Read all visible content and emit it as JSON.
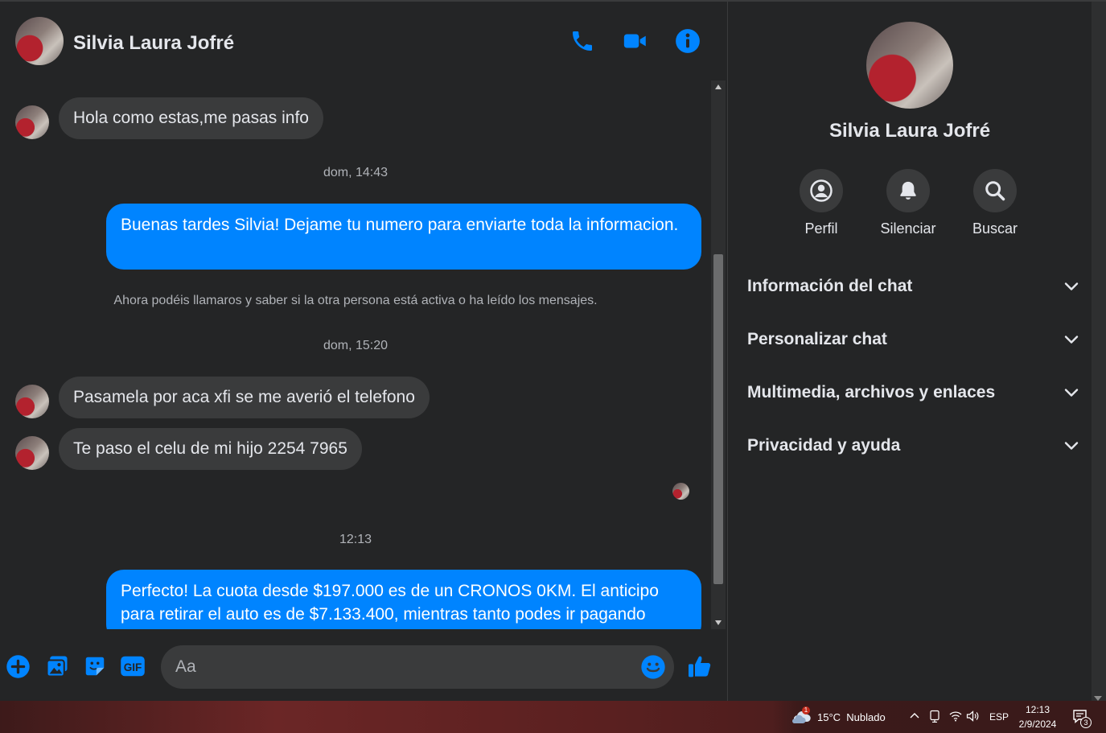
{
  "contact": {
    "name": "Silvia Laura Jofré"
  },
  "messages": [
    {
      "type": "in",
      "text": "Hola como estas,me pasas info"
    },
    {
      "type": "stamp",
      "text": "dom, 14:43"
    },
    {
      "type": "out",
      "text": "Buenas tardes Silvia! Dejame tu numero para enviarte toda la informacion."
    },
    {
      "type": "system",
      "text": "Ahora podéis llamaros y saber si la otra persona está activa o ha leído los mensajes."
    },
    {
      "type": "stamp",
      "text": "dom, 15:20"
    },
    {
      "type": "in",
      "text": "Pasamela por aca xfi se me averió el telefono"
    },
    {
      "type": "in",
      "text": "Te paso el celu de mi hijo 2254 7965"
    },
    {
      "type": "stamp",
      "text": "12:13"
    },
    {
      "type": "out",
      "text": "Perfecto! La cuota desde $197.000 es de un CRONOS 0KM. El anticipo para retirar el auto es de $7.133.400, mientras tanto podes ir pagando"
    }
  ],
  "composer": {
    "placeholder": "Aa"
  },
  "info_panel": {
    "actions": [
      {
        "label": "Perfil",
        "icon": "profile-icon"
      },
      {
        "label": "Silenciar",
        "icon": "bell-icon"
      },
      {
        "label": "Buscar",
        "icon": "search-icon"
      }
    ],
    "sections": [
      "Información del chat",
      "Personalizar chat",
      "Multimedia, archivos y enlaces",
      "Privacidad y ayuda"
    ]
  },
  "taskbar": {
    "weather": "15°C  Nublado",
    "weather_badge": "1",
    "language": "ESP",
    "time": "12:13",
    "date": "2/9/2024",
    "notifications": "3"
  },
  "colors": {
    "accent": "#0084ff",
    "bubble_in": "#3a3b3c",
    "background": "#242526"
  }
}
